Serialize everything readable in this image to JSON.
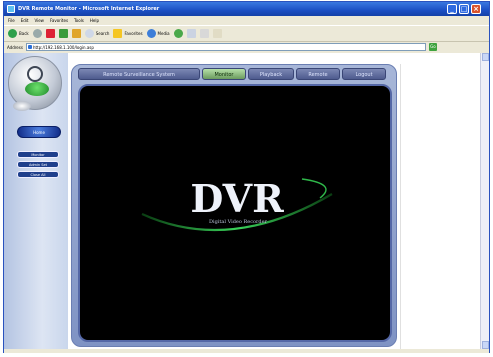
{
  "window": {
    "title": "DVR Remote Monitor - Microsoft Internet Explorer",
    "min": "_",
    "max": "□",
    "close": "×"
  },
  "menu": [
    "File",
    "Edit",
    "View",
    "Favorites",
    "Tools",
    "Help"
  ],
  "toolbar": {
    "back": "Back",
    "search": "Search",
    "favorites": "Favorites",
    "media": "Media"
  },
  "address": {
    "label": "Address",
    "url": "http://192.168.1.100/login.asp",
    "go": "Go"
  },
  "app": {
    "sidebar": {
      "main_button": "Home",
      "buttons": [
        "Monitor",
        "Admin Set",
        "Close All"
      ]
    },
    "tabs": [
      {
        "label": "Remote Surveillance System",
        "active": false
      },
      {
        "label": "Monitor",
        "active": true
      },
      {
        "label": "Playback",
        "active": false
      },
      {
        "label": "Remote",
        "active": false
      },
      {
        "label": "Logout",
        "active": false
      }
    ],
    "logo": {
      "title": "DVR",
      "subtitle": "Digital Video Recorder"
    }
  },
  "colors": {
    "accent": "#1b4fc4",
    "screen": "#000000",
    "logo_swoosh": "#2fb84a"
  }
}
